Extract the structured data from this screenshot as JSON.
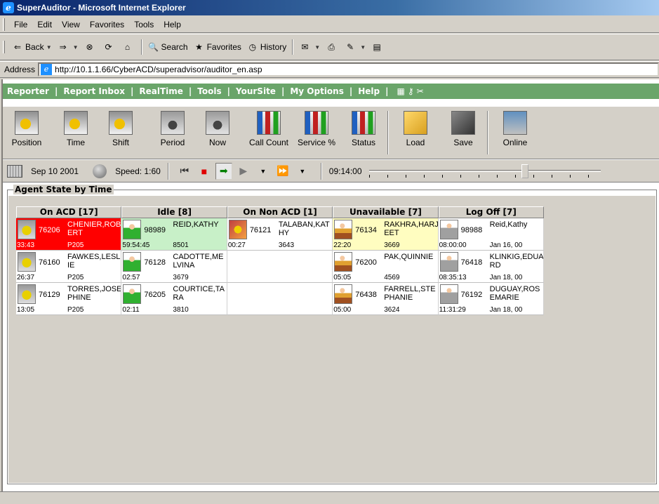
{
  "window": {
    "title": "SuperAuditor - Microsoft Internet Explorer"
  },
  "menu": [
    "File",
    "Edit",
    "View",
    "Favorites",
    "Tools",
    "Help"
  ],
  "toolbar": {
    "back": "Back",
    "search": "Search",
    "favorites": "Favorites",
    "history": "History"
  },
  "address": {
    "label": "Address",
    "url": "http://10.1.1.66/CyberACD/superadvisor/auditor_en.asp"
  },
  "nav": {
    "items": [
      "Reporter",
      "Report Inbox",
      "RealTime",
      "Tools",
      "YourSite",
      "My Options",
      "Help"
    ],
    "separator": "|"
  },
  "appbar": {
    "buttons": [
      {
        "label": "Position",
        "icon": "position-icon"
      },
      {
        "label": "Time",
        "icon": "time-icon"
      },
      {
        "label": "Shift",
        "icon": "shift-icon"
      },
      {
        "label": "Period",
        "icon": "period-icon"
      },
      {
        "label": "Now",
        "icon": "now-icon"
      },
      {
        "label": "Call Count",
        "icon": "call-count-icon"
      },
      {
        "label": "Service %",
        "icon": "service-percent-icon"
      },
      {
        "label": "Status",
        "icon": "status-icon"
      },
      {
        "label": "Load",
        "icon": "load-icon"
      },
      {
        "label": "Save",
        "icon": "save-icon"
      },
      {
        "label": "Online",
        "icon": "online-icon"
      }
    ]
  },
  "playback": {
    "date": "Sep 10 2001",
    "speed": "Speed: 1:60",
    "time": "09:14:00",
    "slider_position": 0.68
  },
  "panel": {
    "title": "Agent State by Time",
    "columns": [
      "On ACD [17]",
      "Idle [8]",
      "On Non ACD [1]",
      "Unavailable [7]",
      "Log Off [7]"
    ],
    "rows": [
      [
        {
          "ext": "76206",
          "name": "CHENIER,ROBERT",
          "dur": "33:43",
          "code": "P205",
          "state": "red",
          "pic": "call"
        },
        {
          "ext": "98989",
          "name": "REID,KATHY",
          "dur": "59:54:45",
          "code": "8501",
          "state": "green",
          "pic": "idle"
        },
        {
          "ext": "76121",
          "name": "TALABAN,KATHY",
          "dur": "00:27",
          "code": "3643",
          "state": "white",
          "pic": "nonacd"
        },
        {
          "ext": "76134",
          "name": "RAKHRA,HARJEET",
          "dur": "22:20",
          "code": "3669",
          "state": "yellow",
          "pic": "unavail"
        },
        {
          "ext": "98988",
          "name": "Reid,Kathy",
          "dur": "08:00:00",
          "code": "Jan 16, 00",
          "state": "white",
          "pic": "logoff"
        }
      ],
      [
        {
          "ext": "76160",
          "name": "FAWKES,LESLIE",
          "dur": "26:37",
          "code": "P205",
          "state": "white",
          "pic": "call"
        },
        {
          "ext": "76128",
          "name": "CADOTTE,MELVINA",
          "dur": "02:57",
          "code": "3679",
          "state": "white",
          "pic": "idle"
        },
        null,
        {
          "ext": "76200",
          "name": "PAK,QUINNIE",
          "dur": "05:05",
          "code": "4569",
          "state": "white",
          "pic": "unavail"
        },
        {
          "ext": "76418",
          "name": "KLINKIG,EDUARD",
          "dur": "08:35:13",
          "code": "Jan 18, 00",
          "state": "white",
          "pic": "logoff"
        }
      ],
      [
        {
          "ext": "76129",
          "name": "TORRES,JOSEPHINE",
          "dur": "13:05",
          "code": "P205",
          "state": "white",
          "pic": "call"
        },
        {
          "ext": "76205",
          "name": "COURTICE,TARA",
          "dur": "02:11",
          "code": "3810",
          "state": "white",
          "pic": "idle"
        },
        null,
        {
          "ext": "76438",
          "name": "FARRELL,STEPHANIE",
          "dur": "05:00",
          "code": "3624",
          "state": "white",
          "pic": "unavail"
        },
        {
          "ext": "76192",
          "name": "DUGUAY,ROSEMARIE",
          "dur": "11:31:29",
          "code": "Jan 18, 00",
          "state": "white",
          "pic": "logoff"
        }
      ]
    ]
  }
}
